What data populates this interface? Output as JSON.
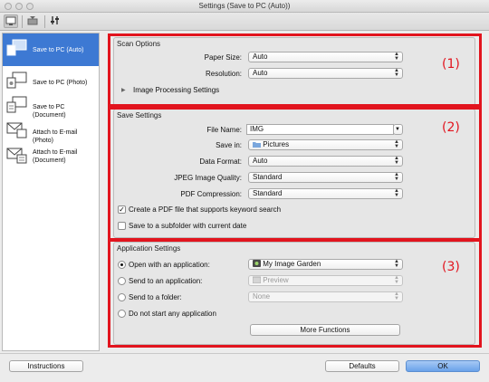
{
  "window": {
    "title": "Settings (Save to PC (Auto))"
  },
  "toolbar": {
    "icons": [
      "scan-from-computer-icon",
      "scan-from-panel-icon",
      "general-settings-icon"
    ]
  },
  "sidebar": {
    "items": [
      {
        "label": "Save to PC (Auto)",
        "icon": "save-to-pc-auto-icon",
        "selected": true
      },
      {
        "label": "Save to PC (Photo)",
        "icon": "save-to-pc-photo-icon",
        "selected": false
      },
      {
        "label": "Save to PC (Document)",
        "icon": "save-to-pc-document-icon",
        "selected": false
      },
      {
        "label": "Attach to E-mail (Photo)",
        "icon": "email-photo-icon",
        "selected": false
      },
      {
        "label": "Attach to E-mail",
        "label2": "(Document)",
        "icon": "email-document-icon",
        "selected": false
      }
    ]
  },
  "scan_options": {
    "title": "Scan Options",
    "paper_size_label": "Paper Size:",
    "paper_size_value": "Auto",
    "resolution_label": "Resolution:",
    "resolution_value": "Auto",
    "image_processing_label": "Image Processing Settings",
    "marker": "(1)"
  },
  "save_settings": {
    "title": "Save Settings",
    "file_name_label": "File Name:",
    "file_name_value": "IMG",
    "save_in_label": "Save in:",
    "save_in_value": "Pictures",
    "data_format_label": "Data Format:",
    "data_format_value": "Auto",
    "jpeg_quality_label": "JPEG Image Quality:",
    "jpeg_quality_value": "Standard",
    "pdf_compression_label": "PDF Compression:",
    "pdf_compression_value": "Standard",
    "keyword_search_label": "Create a PDF file that supports keyword search",
    "keyword_search_checked": true,
    "subfolder_label": "Save to a subfolder with current date",
    "subfolder_checked": false,
    "marker": "(2)"
  },
  "application_settings": {
    "title": "Application Settings",
    "open_app_label": "Open with an application:",
    "open_app_value": "My Image Garden",
    "send_app_label": "Send to an application:",
    "send_app_value": "Preview",
    "send_folder_label": "Send to a folder:",
    "send_folder_value": "None",
    "no_app_label": "Do not start any application",
    "more_functions_label": "More Functions",
    "marker": "(3)"
  },
  "footer": {
    "instructions_label": "Instructions",
    "defaults_label": "Defaults",
    "ok_label": "OK"
  },
  "colors": {
    "accent_red": "#e2141e",
    "selection_blue": "#3d79d3",
    "ok_button_blue": "#6aa2ea"
  }
}
